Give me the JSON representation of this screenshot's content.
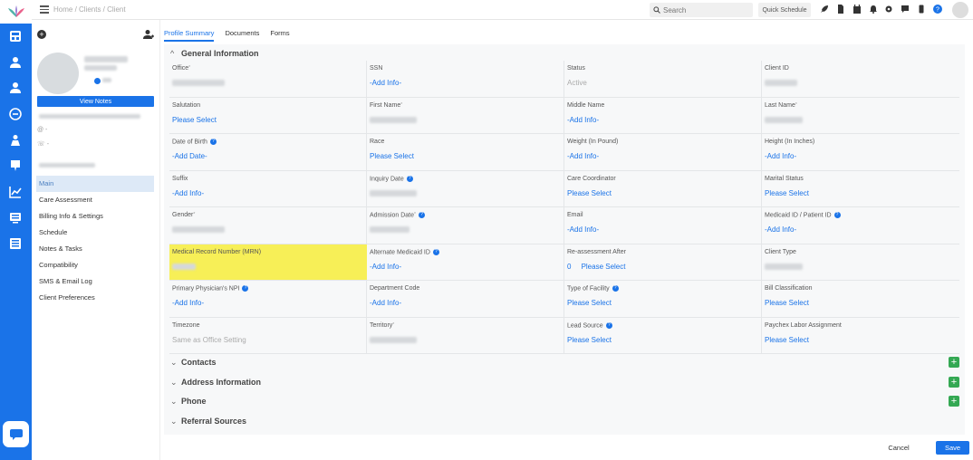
{
  "colors": {
    "primary": "#1a73e8",
    "highlight": "#f7ef57",
    "add_green": "#34a853"
  },
  "topbar": {
    "breadcrumb": "Home / Clients / Client",
    "search_placeholder": "Search",
    "quick_schedule": "Quick Schedule",
    "icons": [
      "rocket-icon",
      "document-icon",
      "calendar-icon",
      "bell-icon",
      "gear-icon",
      "chat-icon",
      "phone-icon",
      "help-icon"
    ]
  },
  "rail": {
    "icons": [
      "dashboard-icon",
      "person-icon",
      "person-add-icon",
      "clock-icon",
      "caregiver-icon",
      "billing-icon",
      "reports-icon",
      "inbox-icon",
      "records-icon",
      "chat-icon"
    ]
  },
  "profile": {
    "view_notes": "View Notes",
    "email_prefix": "@ -",
    "phone_prefix": "☏ -",
    "menu": [
      {
        "label": "Main",
        "active": true
      },
      {
        "label": "Care Assessment",
        "active": false
      },
      {
        "label": "Billing Info & Settings",
        "active": false
      },
      {
        "label": "Schedule",
        "active": false
      },
      {
        "label": "Notes & Tasks",
        "active": false
      },
      {
        "label": "Compatibility",
        "active": false
      },
      {
        "label": "SMS & Email Log",
        "active": false
      },
      {
        "label": "Client Preferences",
        "active": false
      }
    ]
  },
  "tabs": [
    "Profile Summary",
    "Documents",
    "Forms"
  ],
  "general": {
    "title": "General Information",
    "fields": [
      {
        "label": "Office",
        "req": true,
        "info": false,
        "value": "",
        "kind": "blur"
      },
      {
        "label": "SSN",
        "req": false,
        "info": false,
        "value": "-Add Info-",
        "kind": "link"
      },
      {
        "label": "Status",
        "req": false,
        "info": false,
        "value": "Active",
        "kind": "grey"
      },
      {
        "label": "Client ID",
        "req": false,
        "info": false,
        "value": "",
        "kind": "blur"
      },
      {
        "label": "Salutation",
        "req": false,
        "info": false,
        "value": "Please Select",
        "kind": "link"
      },
      {
        "label": "First Name",
        "req": true,
        "info": false,
        "value": "",
        "kind": "blur"
      },
      {
        "label": "Middle Name",
        "req": false,
        "info": false,
        "value": "-Add Info-",
        "kind": "link"
      },
      {
        "label": "Last Name",
        "req": true,
        "info": false,
        "value": "",
        "kind": "blur"
      },
      {
        "label": "Date of Birth",
        "req": false,
        "info": true,
        "value": "-Add Date-",
        "kind": "link"
      },
      {
        "label": "Race",
        "req": false,
        "info": false,
        "value": "Please Select",
        "kind": "link"
      },
      {
        "label": "Weight (In Pound)",
        "req": false,
        "info": false,
        "value": "-Add Info-",
        "kind": "link"
      },
      {
        "label": "Height (In Inches)",
        "req": false,
        "info": false,
        "value": "-Add Info-",
        "kind": "link"
      },
      {
        "label": "Suffix",
        "req": false,
        "info": false,
        "value": "-Add Info-",
        "kind": "link"
      },
      {
        "label": "Inquiry Date",
        "req": false,
        "info": true,
        "value": "",
        "kind": "blur"
      },
      {
        "label": "Care Coordinator",
        "req": false,
        "info": false,
        "value": "Please Select",
        "kind": "link"
      },
      {
        "label": "Marital Status",
        "req": false,
        "info": false,
        "value": "Please Select",
        "kind": "link"
      },
      {
        "label": "Gender",
        "req": true,
        "info": false,
        "value": "",
        "kind": "blur"
      },
      {
        "label": "Admission Date",
        "req": true,
        "info": true,
        "value": "",
        "kind": "blur"
      },
      {
        "label": "Email",
        "req": false,
        "info": false,
        "value": "-Add Info-",
        "kind": "link"
      },
      {
        "label": "Medicaid ID / Patient ID",
        "req": false,
        "info": true,
        "value": "-Add Info-",
        "kind": "link"
      },
      {
        "label": "Medical Record Number (MRN)",
        "req": false,
        "info": false,
        "value": "",
        "kind": "blur",
        "highlight": true
      },
      {
        "label": "Alternate Medicaid ID",
        "req": false,
        "info": true,
        "value": "-Add Info-",
        "kind": "link"
      },
      {
        "label": "Re-assessment After",
        "req": false,
        "info": false,
        "value": "0     Please Select",
        "kind": "link"
      },
      {
        "label": "Client Type",
        "req": false,
        "info": false,
        "value": "",
        "kind": "blur"
      },
      {
        "label": "Primary Physician's NPI",
        "req": false,
        "info": true,
        "value": "-Add Info-",
        "kind": "link"
      },
      {
        "label": "Department Code",
        "req": false,
        "info": false,
        "value": "-Add Info-",
        "kind": "link"
      },
      {
        "label": "Type of Facility",
        "req": false,
        "info": true,
        "value": "Please Select",
        "kind": "link"
      },
      {
        "label": "Bill Classification",
        "req": false,
        "info": false,
        "value": "Please Select",
        "kind": "link"
      },
      {
        "label": "Timezone",
        "req": false,
        "info": false,
        "value": "Same as Office Setting",
        "kind": "grey"
      },
      {
        "label": "Territory",
        "req": true,
        "info": false,
        "value": "",
        "kind": "blur"
      },
      {
        "label": "Lead Source",
        "req": false,
        "info": true,
        "value": "Please Select",
        "kind": "link"
      },
      {
        "label": "Paychex Labor Assignment",
        "req": false,
        "info": false,
        "value": "Please Select",
        "kind": "link"
      }
    ]
  },
  "sections": [
    {
      "title": "Contacts",
      "add": true
    },
    {
      "title": "Address Information",
      "add": true
    },
    {
      "title": "Phone",
      "add": true
    },
    {
      "title": "Referral Sources",
      "add": false
    }
  ],
  "footer": {
    "cancel": "Cancel",
    "save": "Save"
  }
}
